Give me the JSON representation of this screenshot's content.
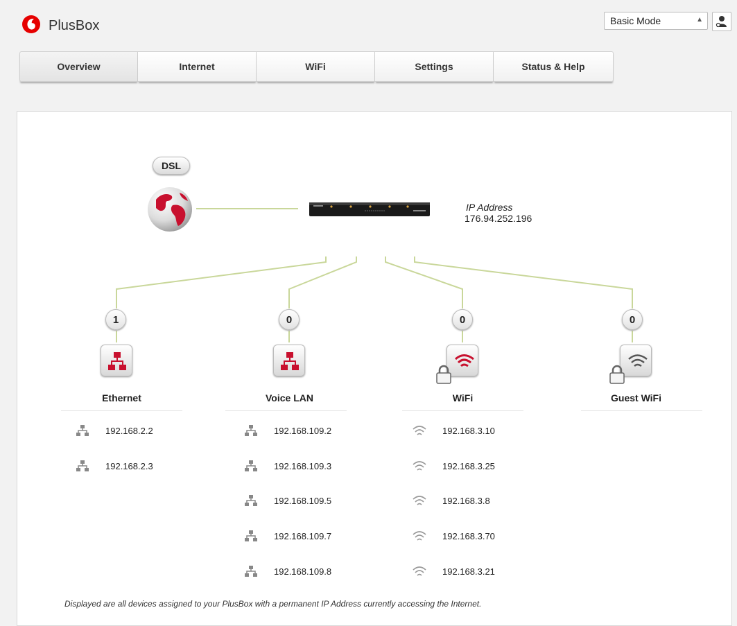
{
  "header": {
    "brand": "PlusBox",
    "mode_selected": "Basic Mode",
    "logo_icon": "vodafone-logo",
    "user_icon": "user-settings-icon",
    "brand_color": "#e60000"
  },
  "tabs": [
    {
      "label": "Overview",
      "active": true
    },
    {
      "label": "Internet",
      "active": false
    },
    {
      "label": "WiFi",
      "active": false
    },
    {
      "label": "Settings",
      "active": false
    },
    {
      "label": "Status & Help",
      "active": false
    }
  ],
  "overview": {
    "dsl_label": "DSL",
    "ip_address_label": "IP Address",
    "ip_address_value": "176.94.252.196",
    "line_color": "#c9d79a",
    "columns": [
      {
        "title": "Ethernet",
        "count": "1",
        "icon": "ethernet-icon",
        "devices": [
          "192.168.2.2",
          "192.168.2.3"
        ]
      },
      {
        "title": "Voice LAN",
        "count": "0",
        "icon": "ethernet-icon",
        "devices": [
          "192.168.109.2",
          "192.168.109.3",
          "192.168.109.5",
          "192.168.109.7",
          "192.168.109.8"
        ]
      },
      {
        "title": "WiFi",
        "count": "0",
        "icon": "wifi-lock-icon",
        "devices": [
          "192.168.3.10",
          "192.168.3.25",
          "192.168.3.8",
          "192.168.3.70",
          "192.168.3.21"
        ]
      },
      {
        "title": "Guest WiFi",
        "count": "0",
        "icon": "guest-wifi-lock-icon",
        "devices": []
      }
    ],
    "footer_note": "Displayed are all devices assigned to your PlusBox with a permanent IP Address currently accessing the Internet."
  }
}
